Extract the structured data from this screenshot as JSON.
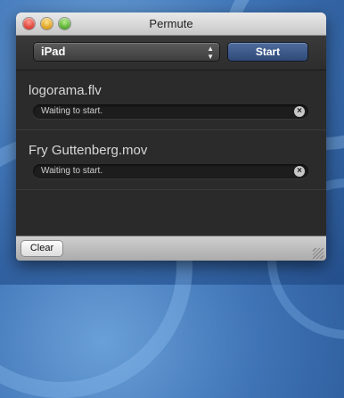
{
  "window": {
    "title": "Permute"
  },
  "toolbar": {
    "preset_value": "iPad",
    "start_label": "Start",
    "select_icon": "up-down-arrows-icon"
  },
  "jobs": [
    {
      "name": "logorama.flv",
      "status": "Waiting to start.",
      "cancel_icon": "cancel-icon"
    },
    {
      "name": "Fry Guttenberg.mov",
      "status": "Waiting to start.",
      "cancel_icon": "cancel-icon"
    }
  ],
  "bottom": {
    "clear_label": "Clear"
  },
  "colors": {
    "start_button": "#3f5b8a",
    "list_background": "#2b2b2b"
  }
}
